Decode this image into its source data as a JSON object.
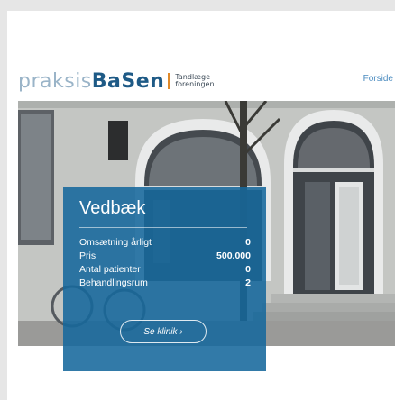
{
  "header": {
    "logo": {
      "part1": "praksis",
      "part2": "BaSen",
      "org_line1": "Tandlæge",
      "org_line2": "foreningen"
    },
    "nav": {
      "home": "Forside"
    }
  },
  "listing": {
    "city": "Vedbæk",
    "stats": [
      {
        "label": "Omsætning årligt",
        "value": "0"
      },
      {
        "label": "Pris",
        "value": "500.000"
      },
      {
        "label": "Antal patienter",
        "value": "0"
      },
      {
        "label": "Behandlingsrum",
        "value": "2"
      }
    ],
    "cta_label": "Se klinik ›"
  },
  "colors": {
    "accent": "#16689c",
    "brand": "#1e5a86",
    "divider": "#e08a2a"
  }
}
